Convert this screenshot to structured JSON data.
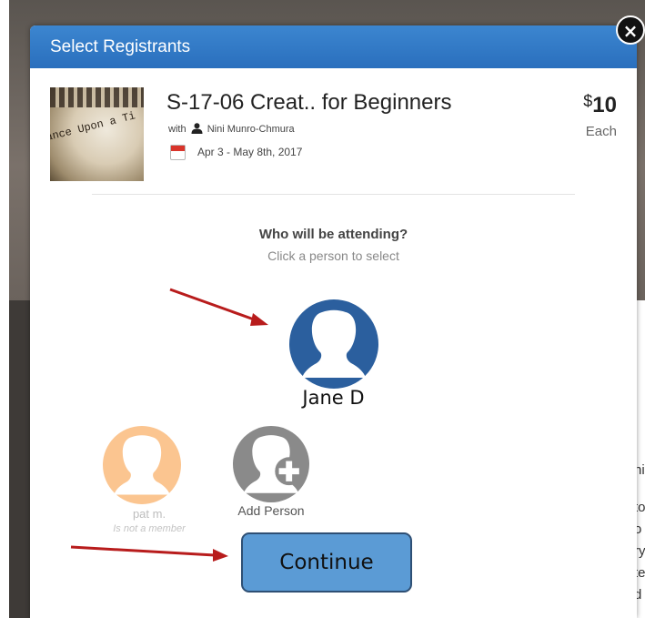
{
  "modal": {
    "title": "Select Registrants",
    "close_label": "×"
  },
  "course": {
    "thumbnail_text": "ance Upon a Ti",
    "thumbnail_keys_text": "1 1 2 0 1",
    "title": "S-17-06 Creat.. for Beginners",
    "with_label": "with",
    "instructor": "Nini Munro-Chmura",
    "dates": "Apr 3 - May 8th, 2017",
    "price_currency": "$",
    "price_amount": "10",
    "price_unit": "Each"
  },
  "prompt": {
    "question": "Who will be attending?",
    "hint": "Click a person to select"
  },
  "people": [
    {
      "name": "Jane D",
      "status": "",
      "color": "#2b5f9e",
      "selectable": true
    },
    {
      "name": "pat m.",
      "status": "Is not a member",
      "color": "#fbc590",
      "selectable": false
    }
  ],
  "add_person_label": "Add Person",
  "add_person_color": "#8a8a8a",
  "continue_label": "Continue",
  "background_side_text": [
    "hi",
    "to",
    "o",
    "ry",
    "te",
    "d"
  ],
  "colors": {
    "header": "#2f75c4",
    "continue_button": "#5b9bd5",
    "annotation_arrow": "#b81c1c"
  },
  "icons": {
    "close": "close-icon",
    "instructor": "person-icon",
    "date": "calendar-icon",
    "avatar": "user-avatar-icon",
    "add": "add-person-icon"
  }
}
